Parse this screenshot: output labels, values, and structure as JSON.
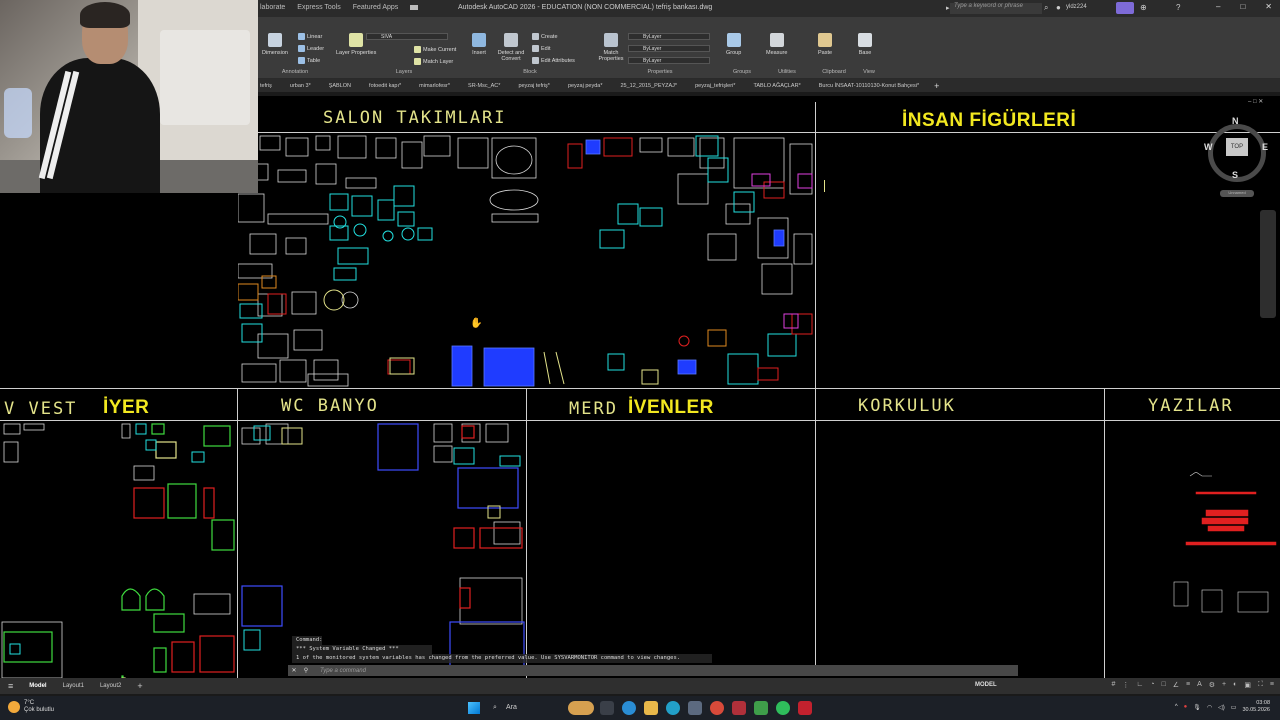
{
  "window": {
    "title": "Autodesk AutoCAD 2026 - EDUCATION (NON COMMERCIAL)   tefriş bankası.dwg",
    "ribbon_tabs": [
      "laborate",
      "Express Tools",
      "Featured Apps"
    ],
    "search_placeholder": "Type a keyword or phrase",
    "user": "yldz224"
  },
  "ribbon": {
    "annotation": {
      "label": "Annotation",
      "dimension": "Dimension",
      "linear": "Linear",
      "leader": "Leader",
      "table": "Table"
    },
    "layers": {
      "label": "Layers",
      "layer_properties": "Layer Properties",
      "current_layer": "SIVA",
      "make_current": "Make Current",
      "match_layer": "Match Layer"
    },
    "block": {
      "label": "Block",
      "insert": "Insert",
      "detect_convert": "Detect and Convert",
      "create": "Create",
      "edit": "Edit",
      "edit_attributes": "Edit Attributes"
    },
    "properties": {
      "label": "Properties",
      "match_properties": "Match Properties",
      "color": "ByLayer",
      "linetype": "ByLayer",
      "lineweight": "ByLayer"
    },
    "groups": {
      "label": "Groups",
      "group": "Group"
    },
    "utilities": {
      "label": "Utilities",
      "measure": "Measure"
    },
    "clipboard": {
      "label": "Clipboard",
      "paste": "Paste"
    },
    "view": {
      "label": "View",
      "base": "Base"
    }
  },
  "file_tabs": [
    "tefriş",
    "urban 3*",
    "ŞABLON",
    "fotoedit kapı*",
    "mimarlofesr*",
    "SR-Msc_AC*",
    "peyzaj tefriş*",
    "peyzaj peyda*",
    "25_12_2015_PEYZAJ*",
    "peyzaj_tefrişleri*",
    "TABLO AĞAÇLAR*",
    "Burcu İNSAAT-10110130-Konut Bahçesi*"
  ],
  "drawing": {
    "titles": {
      "salon": "SALON TAKIMLARI",
      "insan": "İNSAN FİGÜRLERİ",
      "vestiyer_a": "V  VEST",
      "vestiyer_b": "İYER",
      "wc": "WC BANYO",
      "merdiven_a": "MERD",
      "merdiven_b": "İVENLER",
      "korkuluk": "KORKULUK",
      "yazilar": "YAZILAR"
    },
    "viewcube": {
      "n": "N",
      "s": "S",
      "e": "E",
      "w": "W",
      "top": "TOP",
      "wcs": "Unnamed"
    }
  },
  "command": {
    "history": [
      "Command:",
      "*** System Variable Changed ***",
      "1 of the monitored system variables has changed from the preferred value. Use SYSVARMONITOR command to view changes."
    ],
    "placeholder": "Type a command"
  },
  "statusbar": {
    "layouts": [
      "Model",
      "Layout1",
      "Layout2"
    ],
    "model_label": "MODEL"
  },
  "taskbar": {
    "weather_temp": "7°C",
    "weather_desc": "Çok bulutlu",
    "search": "Ara",
    "time": "03:08",
    "date": "30.05.2026"
  },
  "colors": {
    "accent": "#0696d7",
    "title_yellow": "#f2e820",
    "cyan": "#22e0e0",
    "red": "#e02020",
    "blue": "#2040ff"
  }
}
